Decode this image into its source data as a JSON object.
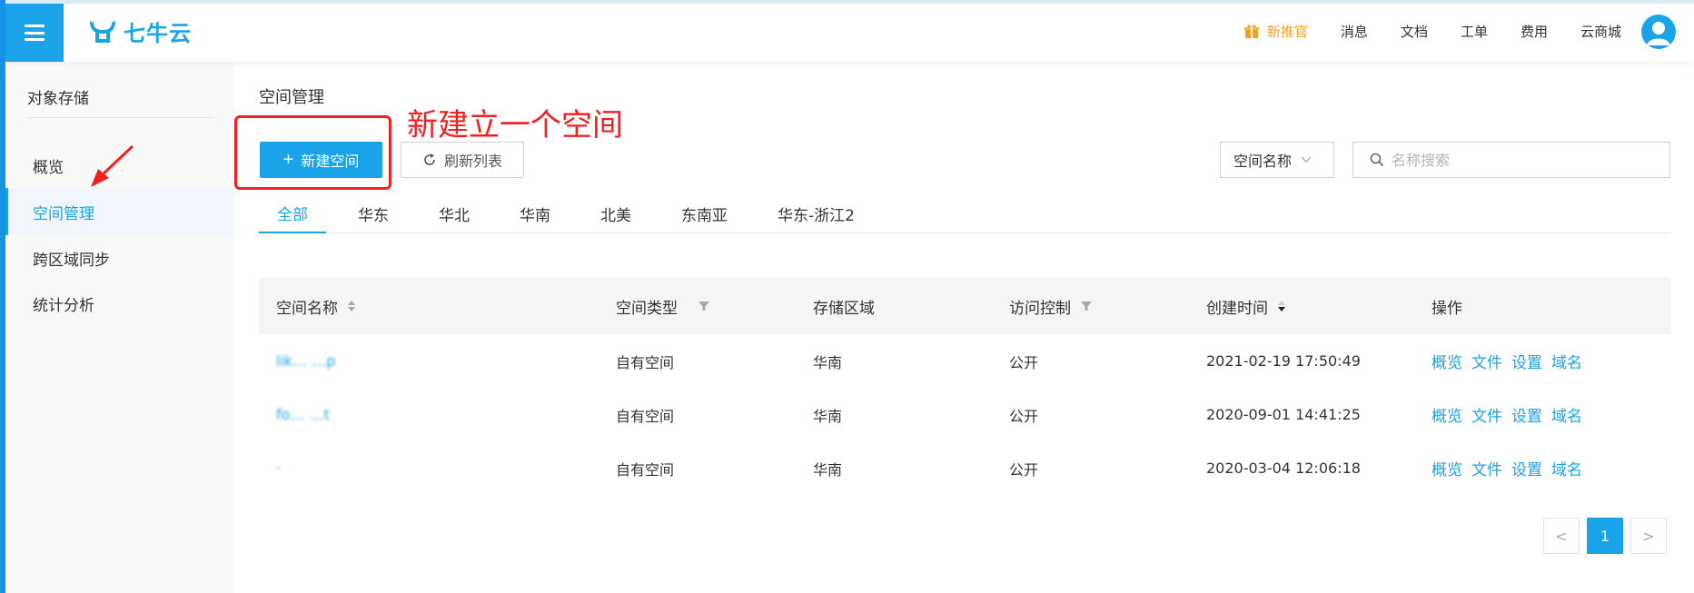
{
  "header": {
    "logo_text": "七牛云",
    "nav": [
      {
        "label": "新推官",
        "accent": true,
        "icon": "gift-icon"
      },
      {
        "label": "消息"
      },
      {
        "label": "文档"
      },
      {
        "label": "工单"
      },
      {
        "label": "费用"
      },
      {
        "label": "云商城"
      }
    ]
  },
  "sidebar": {
    "title": "对象存储",
    "items": [
      {
        "label": "概览",
        "active": false
      },
      {
        "label": "空间管理",
        "active": true
      },
      {
        "label": "跨区域同步",
        "active": false
      },
      {
        "label": "统计分析",
        "active": false
      }
    ]
  },
  "main": {
    "title": "空间管理",
    "create_button": "新建空间",
    "refresh_button": "刷新列表",
    "annotation": "新建立一个空间",
    "filter_select": "空间名称",
    "search_placeholder": "名称搜索",
    "tabs": [
      "全部",
      "华东",
      "华北",
      "华南",
      "北美",
      "东南亚",
      "华东-浙江2"
    ],
    "active_tab": 0
  },
  "table": {
    "columns": [
      "空间名称",
      "空间类型",
      "存储区域",
      "访问控制",
      "创建时间",
      "操作"
    ],
    "rows": [
      {
        "name": "lik… …p",
        "type": "自有空间",
        "region": "华南",
        "access": "公开",
        "created": "2021-02-19 17:50:49"
      },
      {
        "name": "fo…  …t",
        "type": "自有空间",
        "region": "华南",
        "access": "公开",
        "created": "2020-09-01 14:41:25"
      },
      {
        "name": "·",
        "type": "自有空间",
        "region": "华南",
        "access": "公开",
        "created": "2020-03-04 12:06:18"
      }
    ],
    "actions": [
      "概览",
      "文件",
      "设置",
      "域名"
    ]
  },
  "pagination": {
    "current": "1",
    "prev": "<",
    "next": ">"
  },
  "colors": {
    "accent": "#1aa3e8",
    "annotation": "#f02020",
    "gift": "#f0a020"
  }
}
